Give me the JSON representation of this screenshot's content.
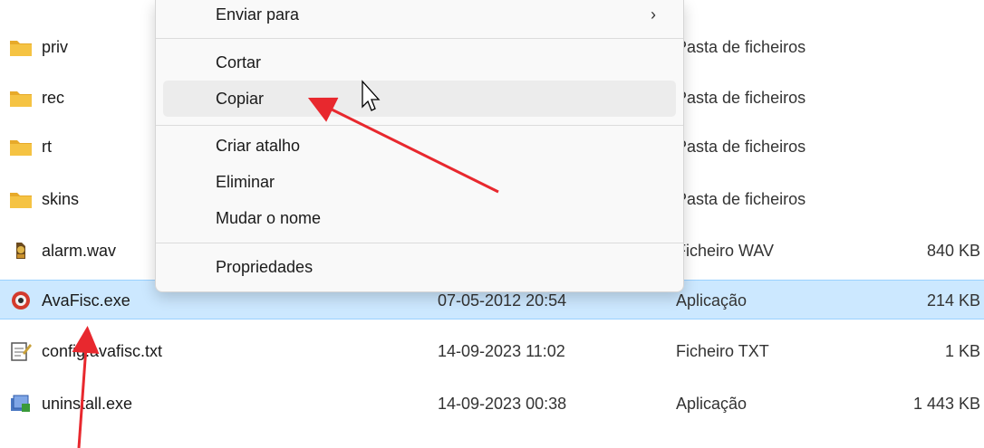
{
  "files": [
    {
      "name": "priv",
      "date": "",
      "type": "Pasta de ficheiros",
      "size": "",
      "icon": "folder-icon"
    },
    {
      "name": "rec",
      "date": "",
      "type": "Pasta de ficheiros",
      "size": "",
      "icon": "folder-icon"
    },
    {
      "name": "rt",
      "date": "",
      "type": "Pasta de ficheiros",
      "size": "",
      "icon": "folder-icon"
    },
    {
      "name": "skins",
      "date": "",
      "type": "Pasta de ficheiros",
      "size": "",
      "icon": "folder-icon"
    },
    {
      "name": "alarm.wav",
      "date": "",
      "type": "Ficheiro WAV",
      "size": "840 KB",
      "icon": "audio-file-icon"
    },
    {
      "name": "AvaFisc.exe",
      "date": "07-05-2012 20:54",
      "type": "Aplicação",
      "size": "214 KB",
      "icon": "app-icon"
    },
    {
      "name": "config.avafisc.txt",
      "date": "14-09-2023 11:02",
      "type": "Ficheiro TXT",
      "size": "1 KB",
      "icon": "text-file-icon"
    },
    {
      "name": "uninstall.exe",
      "date": "14-09-2023 00:38",
      "type": "Aplicação",
      "size": "1 443 KB",
      "icon": "uninstall-icon"
    }
  ],
  "context_menu": {
    "items": [
      {
        "label": "Enviar para",
        "submenu": "›"
      },
      {
        "label": "Cortar"
      },
      {
        "label": "Copiar"
      },
      {
        "label": "Criar atalho"
      },
      {
        "label": "Eliminar"
      },
      {
        "label": "Mudar o nome"
      },
      {
        "label": "Propriedades"
      }
    ]
  },
  "colors": {
    "selected_row": "#cce8ff",
    "arrow": "#e8282e",
    "folder": "#f5c343"
  }
}
